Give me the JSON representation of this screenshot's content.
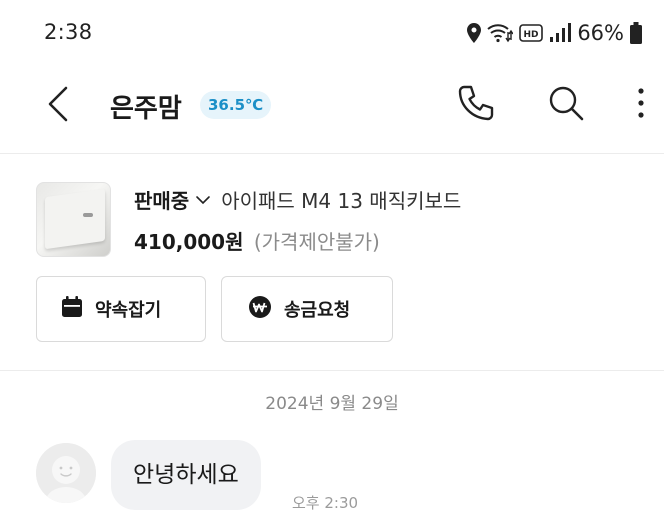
{
  "status_bar": {
    "time": "2:38",
    "battery": "66%",
    "icons": [
      "location-icon",
      "wifi-icon",
      "hd-icon",
      "signal-icon",
      "battery-icon"
    ]
  },
  "header": {
    "name": "은주맘",
    "temperature": "36.5℃",
    "icons": [
      "back-icon",
      "phone-icon",
      "search-icon",
      "more-icon"
    ]
  },
  "product": {
    "sale_status": "판매중",
    "title": "아이패드 M4 13 매직키보드",
    "price": "410,000원",
    "price_note": "(가격제안불가)",
    "buttons": {
      "appointment": "약속잡기",
      "payment": "송금요청"
    }
  },
  "chat": {
    "date": "2024년 9월 29일",
    "messages": [
      {
        "text": "안녕하세요",
        "time": "오후 2:30"
      }
    ]
  },
  "colors": {
    "temperature_bg": "#e6f4fb",
    "temperature_text": "#1b8fc7",
    "bubble_bg": "#f1f2f4"
  }
}
